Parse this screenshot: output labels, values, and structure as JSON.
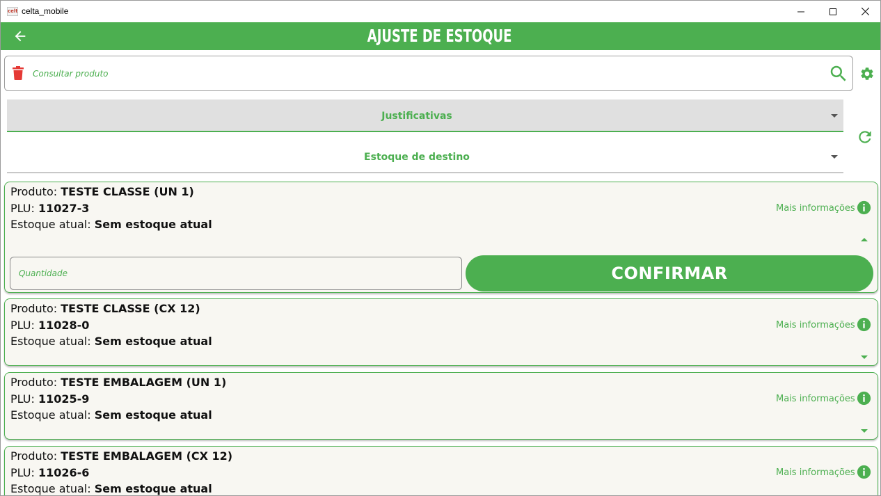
{
  "window": {
    "app_icon_text": "celta",
    "title": "celta_mobile"
  },
  "appbar": {
    "title": "AJUSTE DE ESTOQUE"
  },
  "search": {
    "placeholder": "Consultar produto"
  },
  "dropdowns": {
    "justificativas": "Justificativas",
    "estoque_destino": "Estoque de destino"
  },
  "labels": {
    "produto": "Produto: ",
    "plu": "PLU: ",
    "estoque_atual": "Estoque atual: ",
    "mais_informacoes": "Mais informações",
    "quantidade_placeholder": "Quantidade",
    "confirmar": "CONFIRMAR"
  },
  "products": [
    {
      "name": "TESTE CLASSE (UN 1)",
      "plu": "11027-3",
      "stock": "Sem estoque atual",
      "expanded": true
    },
    {
      "name": "TESTE CLASSE (CX 12)",
      "plu": "11028-0",
      "stock": "Sem estoque atual",
      "expanded": false
    },
    {
      "name": "TESTE EMBALAGEM (UN 1)",
      "plu": "11025-9",
      "stock": "Sem estoque atual",
      "expanded": false
    },
    {
      "name": "TESTE EMBALAGEM (CX 12)",
      "plu": "11026-6",
      "stock": "Sem estoque atual",
      "expanded": false
    }
  ],
  "colors": {
    "primary": "#4caf50",
    "delete": "#e53935",
    "card_bg": "#f8f7f2",
    "dropdown_bg": "#e0e0e0"
  }
}
